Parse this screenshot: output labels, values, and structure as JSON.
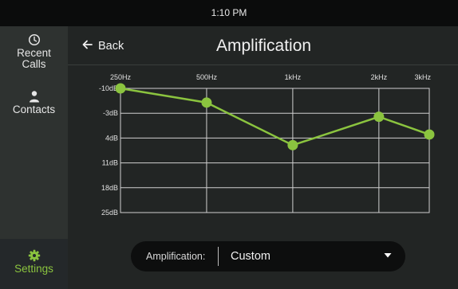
{
  "status": {
    "time": "1:10 PM"
  },
  "sidebar": {
    "items": [
      {
        "label_line1": "Recent",
        "label_line2": "Calls",
        "icon": "clock-icon"
      },
      {
        "label": "Contacts",
        "icon": "person-icon"
      },
      {
        "label": "Settings",
        "icon": "gear-icon",
        "active": true
      }
    ]
  },
  "header": {
    "back_label": "Back",
    "title": "Amplification"
  },
  "accent_color": "#8bc43f",
  "chart_data": {
    "type": "line",
    "x": [
      "250Hz",
      "500Hz",
      "1kHz",
      "2kHz",
      "3kHz"
    ],
    "x_positions_hz": [
      250,
      500,
      1000,
      2000,
      3000
    ],
    "y_ticks": [
      "-10dB",
      "-3dB",
      "4dB",
      "11dB",
      "18dB",
      "25dB"
    ],
    "ylim": [
      -10,
      25
    ],
    "y_inverted": true,
    "series": [
      {
        "values": [
          -10,
          -6,
          6,
          -2,
          3
        ]
      }
    ]
  },
  "dropdown": {
    "label": "Amplification:",
    "value": "Custom"
  }
}
